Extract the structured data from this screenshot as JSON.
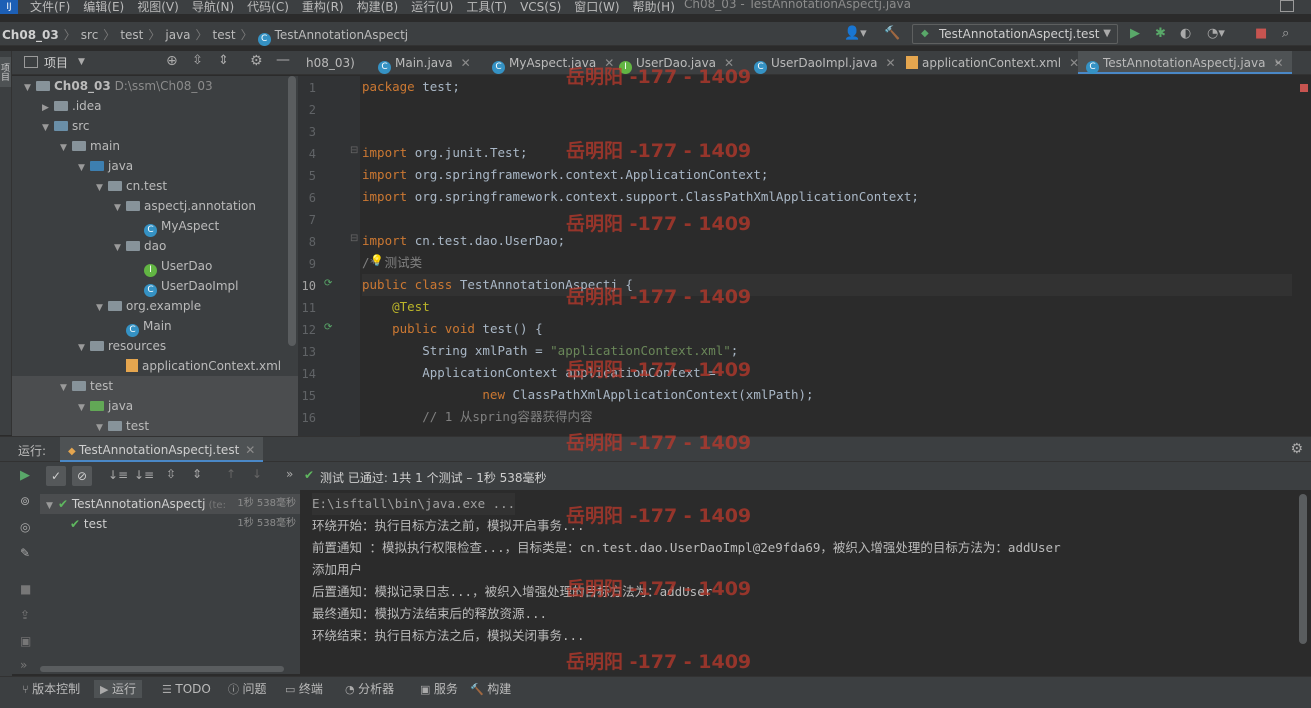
{
  "menubar": {
    "items": [
      "文件(F)",
      "编辑(E)",
      "视图(V)",
      "导航(N)",
      "代码(C)",
      "重构(R)",
      "构建(B)",
      "运行(U)",
      "工具(T)",
      "VCS(S)",
      "窗口(W)",
      "帮助(H)"
    ],
    "window_title": "Ch08_03 - TestAnnotationAspectj.java"
  },
  "breadcrumb": [
    "Ch08_03",
    "src",
    "test",
    "java",
    "test",
    "TestAnnotationAspectj"
  ],
  "run_config": "TestAnnotationAspectj.test",
  "project_panel": {
    "title": "项目",
    "rows": [
      {
        "label": "Ch08_03",
        "path": "D:\\ssm\\Ch08_03"
      },
      {
        "label": ".idea"
      },
      {
        "label": "src"
      },
      {
        "label": "main"
      },
      {
        "label": "java"
      },
      {
        "label": "cn.test"
      },
      {
        "label": "aspectj.annotation"
      },
      {
        "label": "MyAspect"
      },
      {
        "label": "dao"
      },
      {
        "label": "UserDao"
      },
      {
        "label": "UserDaoImpl"
      },
      {
        "label": "org.example"
      },
      {
        "label": "Main"
      },
      {
        "label": "resources"
      },
      {
        "label": "applicationContext.xml"
      },
      {
        "label": "test"
      },
      {
        "label": "java"
      },
      {
        "label": "test"
      }
    ]
  },
  "editor_tabs": [
    {
      "label": "h08_03)",
      "active": false
    },
    {
      "label": "Main.java",
      "active": false
    },
    {
      "label": "MyAspect.java",
      "active": false
    },
    {
      "label": "UserDao.java",
      "active": false
    },
    {
      "label": "UserDaoImpl.java",
      "active": false
    },
    {
      "label": "applicationContext.xml",
      "active": false
    },
    {
      "label": "TestAnnotationAspectj.java",
      "active": true
    }
  ],
  "code": {
    "line_numbers": [
      "1",
      "2",
      "3",
      "4",
      "5",
      "6",
      "7",
      "8",
      "9",
      "10",
      "11",
      "12",
      "13",
      "14",
      "15",
      "16"
    ],
    "lines": [
      {
        "k": "package ",
        "t": "test;"
      },
      {
        "k": "",
        "t": ""
      },
      {
        "k": "",
        "t": ""
      },
      {
        "k": "import ",
        "t": "org.junit.Test;"
      },
      {
        "k": "import ",
        "t": "org.springframework.context.ApplicationContext;"
      },
      {
        "k": "import ",
        "t": "org.springframework.context.support.ClassPathXmlApplicationContext;"
      },
      {
        "k": "",
        "t": ""
      },
      {
        "k": "import ",
        "t": "cn.test.dao.UserDao;"
      },
      {
        "k": "",
        "t": "/* 测试类"
      },
      {
        "k": "public class ",
        "t": "TestAnnotationAspectj {"
      },
      {
        "k": "",
        "t": "    @Test"
      },
      {
        "k": "    public void ",
        "t": "test() {"
      },
      {
        "k": "",
        "t": "        String xmlPath = ",
        "s": "\"applicationContext.xml\"",
        "e": ";"
      },
      {
        "k": "",
        "t": "        ApplicationContext applicationContext ="
      },
      {
        "k": "                new ",
        "t": "ClassPathXmlApplicationContext(xmlPath);"
      },
      {
        "k": "",
        "t": "        // 1 从spring容器获得内容"
      }
    ]
  },
  "watermark": "岳明阳 -177 - 1409",
  "run_panel": {
    "label": "运行:",
    "tab": "TestAnnotationAspectj.test",
    "status": "测试 已通过: 1共 1 个测试 – 1秒 538毫秒",
    "tree": [
      {
        "label": "TestAnnotationAspectj",
        "extra": "(te:",
        "time": "1秒 538毫秒"
      },
      {
        "label": "test",
        "time": "1秒 538毫秒"
      }
    ],
    "console": [
      "E:\\isftall\\bin\\java.exe ...",
      "环绕开始：执行目标方法之前，模拟开启事务...",
      "前置通知 ：模拟执行权限检查...，目标类是：cn.test.dao.UserDaoImpl@2e9fda69，被织入增强处理的目标方法为：addUser",
      "添加用户",
      "后置通知：模拟记录日志...，被织入增强处理的目标方法为：addUser",
      "最终通知：模拟方法结束后的释放资源...",
      "环绕结束：执行目标方法之后，模拟关闭事务..."
    ]
  },
  "bottom_tabs": [
    "版本控制",
    "运行",
    "TODO",
    "问题",
    "终端",
    "分析器",
    "服务",
    "构建"
  ],
  "colors": {
    "accent": "#4a88c7",
    "pass": "#5fb85f",
    "watermark": "#c0392b"
  }
}
